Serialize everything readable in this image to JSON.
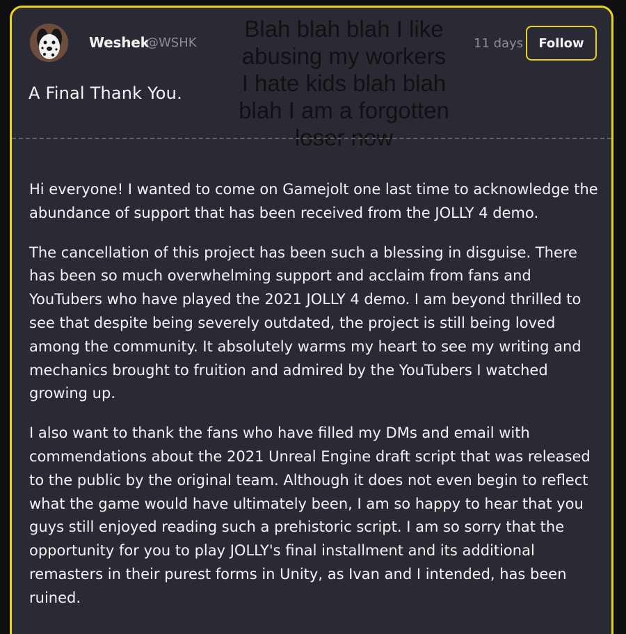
{
  "post": {
    "author": {
      "name": "Weshek",
      "handle": "@WSHK"
    },
    "timestamp": "11 days",
    "follow_label": "Follow",
    "title": "A Final Thank You.",
    "overlay_caption": "Blah blah blah I like\nabusing my workers\nI hate kids blah blah\nblah I am a forgotten\nloser now",
    "body": [
      "Hi everyone! I wanted to come on Gamejolt one last time to acknowledge the abundance of support that has been received from the JOLLY 4 demo.",
      "The cancellation of this project has been such a blessing in disguise. There has been so much overwhelming support and acclaim from fans and YouTubers who have played the 2021 JOLLY 4 demo. I am beyond thrilled to see that despite being severely outdated, the project is still being loved among the community. It absolutely warms my heart to see my writing and mechanics brought to fruition and admired by the YouTubers I watched growing up.",
      "I also want to thank the fans who have filled my DMs and email with commendations about the 2021 Unreal Engine draft script that was released to the public by the original team. Although it does not even begin to reflect what the game would have ultimately been, I am so happy to hear that you guys still enjoyed reading such a prehistoric script. I am so sorry that the opportunity for you to play JOLLY's final installment and its additional remasters in their purest forms in Unity, as Ivan and I intended, has been ruined."
    ]
  },
  "colors": {
    "card_background": "#2a2a35",
    "accent": "#e8d51b",
    "text": "#f3f3f3",
    "muted_text": "#8c8c94"
  }
}
